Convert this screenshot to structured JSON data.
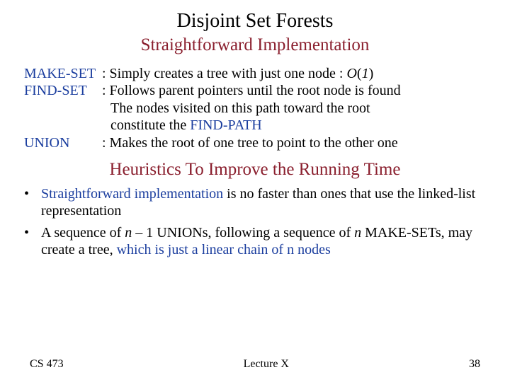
{
  "title": "Disjoint Set Forests",
  "subtitle": "Straightforward Implementation",
  "defs": {
    "makeset": {
      "key": "MAKE-SET",
      "pre": ": Simply creates a tree with just one node : ",
      "bigO_O": "O",
      "bigO_paren": "(",
      "bigO_one": "1",
      "bigO_close": ")"
    },
    "findset": {
      "key": "FIND-SET",
      "line1": ": Follows parent pointers until the root node is found",
      "line2a": "The nodes visited on this path toward the root",
      "line2b_plain": "constitute the ",
      "line2b_blue": "FIND-PATH"
    },
    "union": {
      "key": "UNION",
      "text": ": Makes the root of one tree to point to the other one"
    }
  },
  "heur_title": "Heuristics To Improve the Running Time",
  "bullets": {
    "b1": {
      "a": "Straightforward implementation",
      "b": " is no faster than ones that use the linked-list representation"
    },
    "b2": {
      "a": "A sequence of ",
      "n1": "n",
      "b": " – 1 UNIONs, following a sequence of ",
      "n2": "n",
      "c": " MAKE-SETs, may create a tree, ",
      "d": "which is just a linear chain of n nodes"
    }
  },
  "footer": {
    "left": "CS 473",
    "center": "Lecture X",
    "right": "38"
  }
}
